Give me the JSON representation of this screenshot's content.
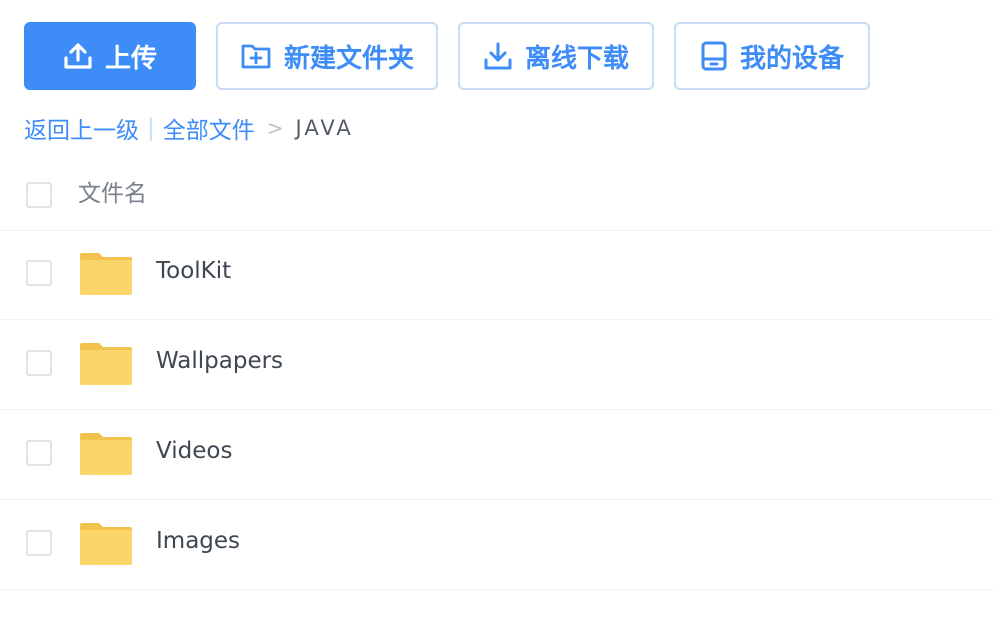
{
  "toolbar": {
    "upload_label": "上传",
    "mkdir_label": "新建文件夹",
    "offline_label": "离线下载",
    "device_label": "我的设备"
  },
  "breadcrumb": {
    "back_label": "返回上一级",
    "separator": "|",
    "root_label": "全部文件",
    "arrow": ">",
    "current": "JAVA"
  },
  "list": {
    "header_label": "文件名",
    "rows": [
      {
        "name": "ToolKit",
        "icon": "folder-icon"
      },
      {
        "name": "Wallpapers",
        "icon": "folder-icon"
      },
      {
        "name": "Videos",
        "icon": "folder-icon"
      },
      {
        "name": "Images",
        "icon": "folder-icon"
      }
    ]
  },
  "colors": {
    "accent": "#3e8cf7",
    "folder": "#fcd56a",
    "folder_tab": "#f2c24f"
  }
}
